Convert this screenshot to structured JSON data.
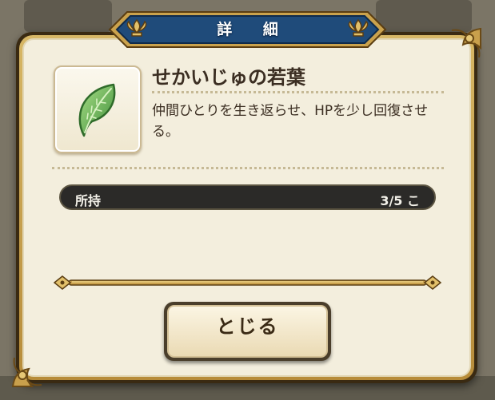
{
  "dialog": {
    "title": "詳 細",
    "item": {
      "name": "せかいじゅの若葉",
      "description": "仲間ひとりを生き返らせ、HPを少し回復させる。",
      "icon": "world-tree-leaf-icon"
    },
    "owned": {
      "label": "所持",
      "count": "3/5 こ"
    },
    "close_label": "とじる"
  },
  "colors": {
    "banner": "#1f4b7a",
    "frame_gold": "#c9a04c",
    "panel": "#f3eedd",
    "leaf": "#5aa54b",
    "text": "#3b2e22"
  }
}
